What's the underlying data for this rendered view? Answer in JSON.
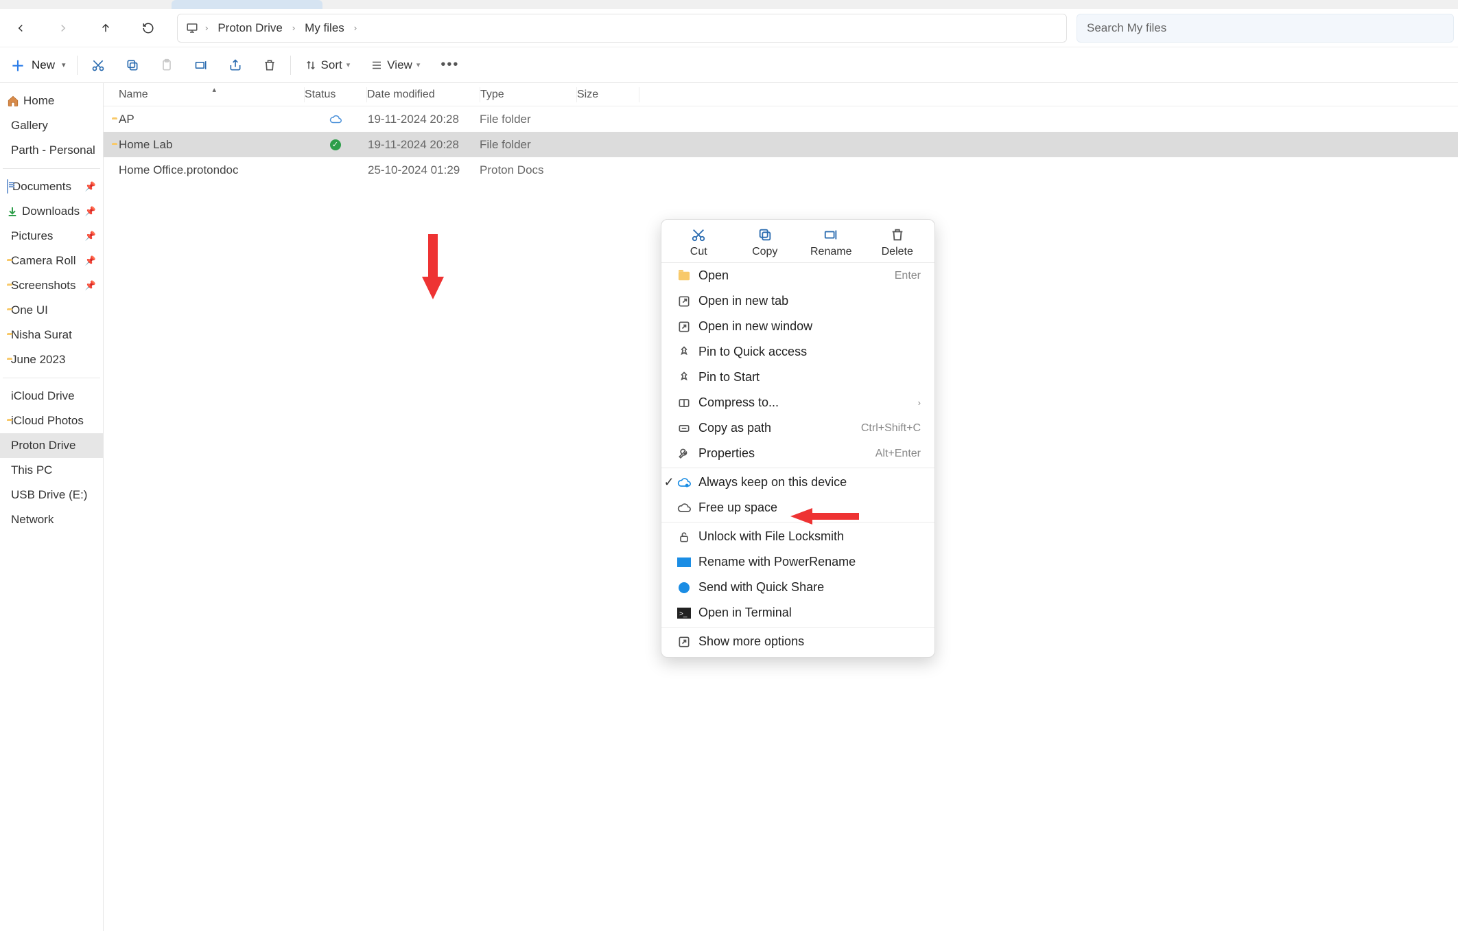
{
  "address": {
    "icon": "monitor",
    "crumbs": [
      "Proton Drive",
      "My files"
    ]
  },
  "search": {
    "placeholder": "Search My files"
  },
  "toolbar": {
    "new_label": "New",
    "sort_label": "Sort",
    "view_label": "View"
  },
  "sidebar": {
    "group1": [
      {
        "label": "Home",
        "icon": "home"
      },
      {
        "label": "Gallery",
        "icon": "gallery"
      },
      {
        "label": "Parth - Personal",
        "icon": "onedrive"
      }
    ],
    "group2": [
      {
        "label": "Documents",
        "icon": "doc",
        "pinned": true
      },
      {
        "label": "Downloads",
        "icon": "dl",
        "pinned": true
      },
      {
        "label": "Pictures",
        "icon": "pic",
        "pinned": true
      },
      {
        "label": "Camera Roll",
        "icon": "folder",
        "pinned": true
      },
      {
        "label": "Screenshots",
        "icon": "folder",
        "pinned": true
      },
      {
        "label": "One UI",
        "icon": "folder"
      },
      {
        "label": "Nisha Surat",
        "icon": "folder"
      },
      {
        "label": "June 2023",
        "icon": "folder"
      }
    ],
    "group3": [
      {
        "label": "iCloud Drive",
        "icon": "onedrive"
      },
      {
        "label": "iCloud Photos",
        "icon": "folder"
      },
      {
        "label": "Proton Drive",
        "icon": "proton",
        "active": true
      },
      {
        "label": "This PC",
        "icon": "pc"
      },
      {
        "label": "USB Drive (E:)",
        "icon": "usb"
      },
      {
        "label": "Network",
        "icon": "net"
      }
    ]
  },
  "columns": {
    "name": "Name",
    "status": "Status",
    "date": "Date modified",
    "type": "Type",
    "size": "Size"
  },
  "rows": [
    {
      "name": "AP",
      "icon": "folder",
      "status": "cloud",
      "date": "19-11-2024 20:28",
      "type": "File folder",
      "size": ""
    },
    {
      "name": "Home Lab",
      "icon": "folder",
      "status": "synced",
      "date": "19-11-2024 20:28",
      "type": "File folder",
      "size": "",
      "selected": true
    },
    {
      "name": "Home Office.protondoc",
      "icon": "protondoc",
      "status": "",
      "date": "25-10-2024 01:29",
      "type": "Proton Docs",
      "size": ""
    }
  ],
  "context_menu": {
    "top": [
      {
        "label": "Cut",
        "icon": "cut"
      },
      {
        "label": "Copy",
        "icon": "copy"
      },
      {
        "label": "Rename",
        "icon": "rename"
      },
      {
        "label": "Delete",
        "icon": "delete"
      }
    ],
    "group1": [
      {
        "label": "Open",
        "icon": "folder-open",
        "shortcut": "Enter"
      },
      {
        "label": "Open in new tab",
        "icon": "newtab"
      },
      {
        "label": "Open in new window",
        "icon": "newwin"
      },
      {
        "label": "Pin to Quick access",
        "icon": "pin"
      },
      {
        "label": "Pin to Start",
        "icon": "pin"
      },
      {
        "label": "Compress to...",
        "icon": "zip",
        "submenu": true
      },
      {
        "label": "Copy as path",
        "icon": "path",
        "shortcut": "Ctrl+Shift+C"
      },
      {
        "label": "Properties",
        "icon": "wrench",
        "shortcut": "Alt+Enter"
      }
    ],
    "group2": [
      {
        "label": "Always keep on this device",
        "icon": "cloud-keep",
        "checked": true
      },
      {
        "label": "Free up space",
        "icon": "cloud"
      }
    ],
    "group3": [
      {
        "label": "Unlock with File Locksmith",
        "icon": "lock"
      },
      {
        "label": "Rename with PowerRename",
        "icon": "powren"
      },
      {
        "label": "Send with Quick Share",
        "icon": "quickshare"
      },
      {
        "label": "Open in Terminal",
        "icon": "terminal"
      }
    ],
    "group4": [
      {
        "label": "Show more options",
        "icon": "more"
      }
    ]
  }
}
